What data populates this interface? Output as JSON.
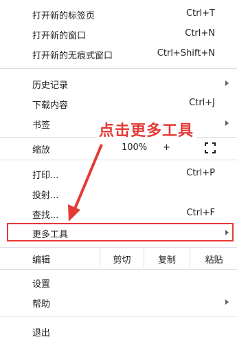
{
  "menu": {
    "new_tab": {
      "label": "打开新的标签页",
      "shortcut": "Ctrl+T"
    },
    "new_window": {
      "label": "打开新的窗口",
      "shortcut": "Ctrl+N"
    },
    "incognito": {
      "label": "打开新的无痕式窗口",
      "shortcut": "Ctrl+Shift+N"
    },
    "history": {
      "label": "历史记录"
    },
    "downloads": {
      "label": "下载内容",
      "shortcut": "Ctrl+J"
    },
    "bookmarks": {
      "label": "书签"
    },
    "zoom": {
      "label": "缩放",
      "minus": "-",
      "value": "100%",
      "plus": "+"
    },
    "print": {
      "label": "打印...",
      "shortcut": "Ctrl+P"
    },
    "cast": {
      "label": "投射..."
    },
    "find": {
      "label": "查找...",
      "shortcut": "Ctrl+F"
    },
    "more_tools": {
      "label": "更多工具"
    },
    "edit": {
      "label": "编辑",
      "cut": "剪切",
      "copy": "复制",
      "paste": "粘贴"
    },
    "settings": {
      "label": "设置"
    },
    "help": {
      "label": "帮助"
    },
    "exit": {
      "label": "退出"
    }
  },
  "annotation": {
    "text": "点击更多工具",
    "color": "#e53935"
  },
  "colors": {
    "separator": "#dadce0",
    "highlight": "#e53935"
  }
}
